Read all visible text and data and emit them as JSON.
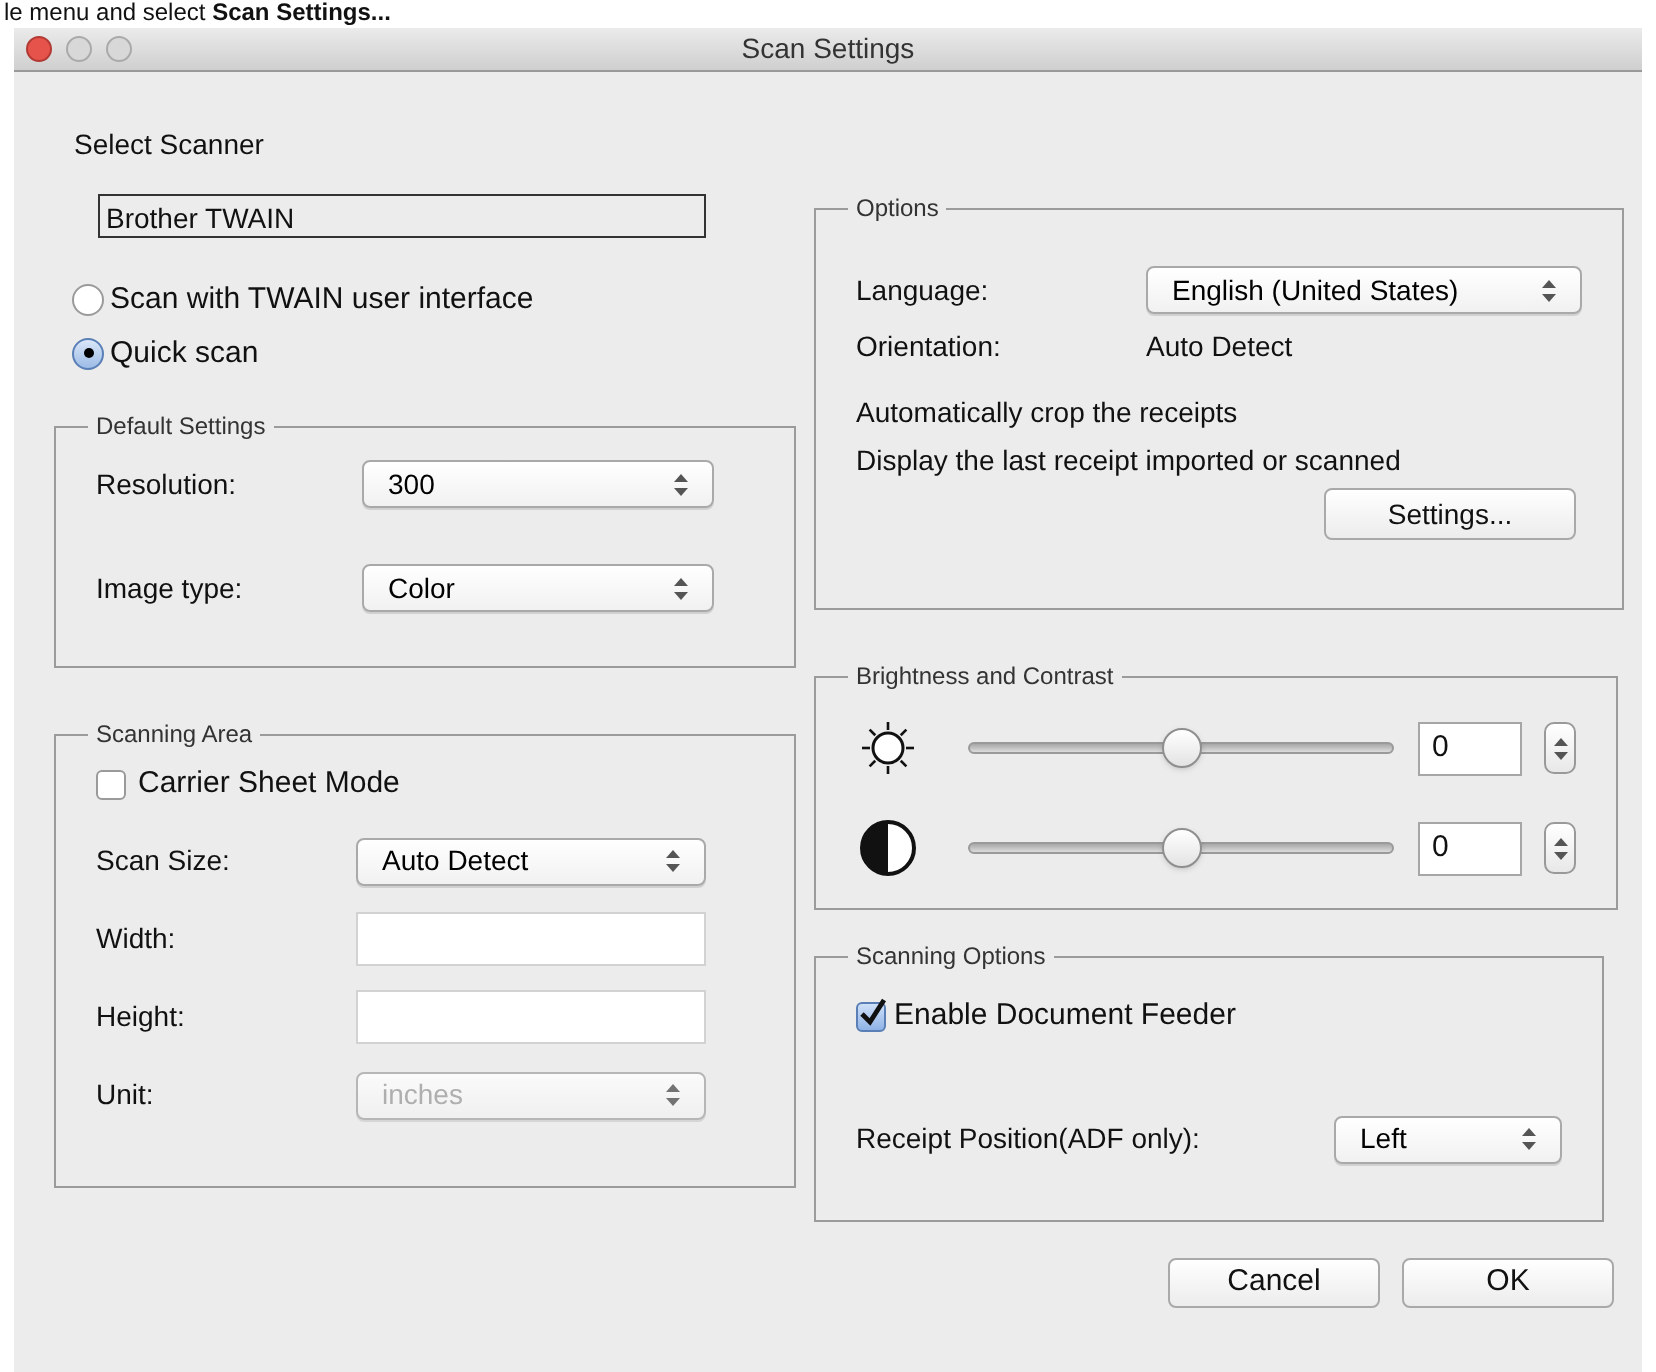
{
  "caption": "le menu and select **Scan Settings...**",
  "window": {
    "title": "Scan Settings"
  },
  "scanner": {
    "label": "Select Scanner",
    "value": "Brother TWAIN"
  },
  "modes": [
    {
      "label": "Scan with TWAIN user interface",
      "selected": false
    },
    {
      "label": "Quick scan",
      "selected": true
    }
  ],
  "default_settings": {
    "title": "Default Settings",
    "fields": [
      {
        "label": "Resolution:",
        "value": "300"
      },
      {
        "label": "Image type:",
        "value": "Color"
      }
    ]
  },
  "scanning_area": {
    "title": "Scanning Area",
    "carrier_sheet": {
      "label": "Carrier Sheet Mode",
      "checked": false
    },
    "fields": [
      {
        "kind": "select",
        "label": "Scan Size:",
        "value": "Auto Detect",
        "disabled": false
      },
      {
        "kind": "text",
        "label": "Width:"
      },
      {
        "kind": "text",
        "label": "Height:"
      },
      {
        "kind": "select",
        "label": "Unit:",
        "value": "inches",
        "disabled": true
      }
    ]
  },
  "options": {
    "title": "Options",
    "language": {
      "label": "Language:",
      "value": "English (United States)"
    },
    "orientation": {
      "label": "Orientation:",
      "value": "Auto Detect"
    },
    "notes": [
      "Automatically crop the receipts",
      "Display the last receipt imported or scanned"
    ],
    "button": "Settings..."
  },
  "brightness_contrast": {
    "title": "Brightness and Contrast",
    "sliders": [
      {
        "kind": "brightness",
        "level": 0.5,
        "value": "0"
      },
      {
        "kind": "contrast",
        "level": 0.5,
        "value": "0"
      }
    ]
  },
  "scanning_options": {
    "title": "Scanning Options",
    "feeder": {
      "label": "Enable Document Feeder",
      "checked": true
    },
    "receipt_position": {
      "label": "Receipt Position(ADF only):",
      "value": "Left"
    }
  },
  "buttons": [
    "Cancel",
    "OK"
  ]
}
